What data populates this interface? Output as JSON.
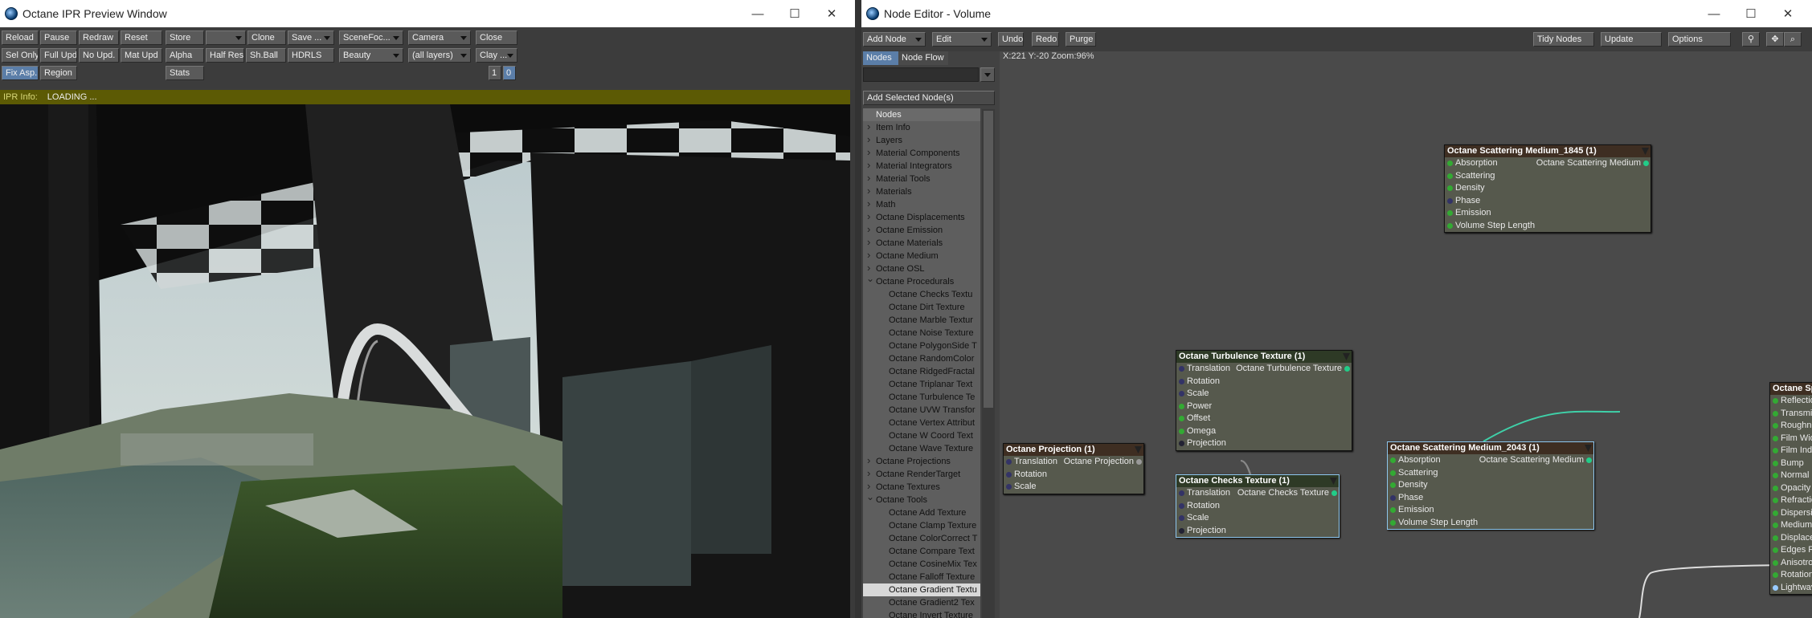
{
  "ipr": {
    "title": "Octane IPR Preview Window",
    "row1": [
      "Reload",
      "Pause",
      "Redraw",
      "Reset",
      "Store",
      "",
      "Clone",
      "Save ...",
      "SceneFoc...",
      "Camera",
      "Close"
    ],
    "row2": [
      "Sel Only",
      "Full Upd.",
      "No Upd.",
      "Mat Upd",
      "Alpha",
      "Half Res",
      "Sh.Ball",
      "HDRLS",
      "Beauty",
      "(all layers)",
      "Clay ..."
    ],
    "row3": [
      "Fix Asp.",
      "Region",
      "Stats",
      "1",
      "0"
    ],
    "info_label": "IPR Info:",
    "info_text": "LOADING ..."
  },
  "node_editor": {
    "title": "Node Editor - Volume",
    "toolbar": [
      "Add Node",
      "Edit",
      "Undo",
      "Redo",
      "Purge",
      "Tidy Nodes",
      "Update",
      "Options"
    ],
    "tabs": [
      "Nodes",
      "Node Flow"
    ],
    "add_selected": "Add Selected Node(s)",
    "coords": "X:221 Y:-20 Zoom:96%",
    "tree_header": "Nodes",
    "tree_items": [
      {
        "label": "Item Info",
        "kind": "cat"
      },
      {
        "label": "Layers",
        "kind": "cat"
      },
      {
        "label": "Material Components",
        "kind": "cat"
      },
      {
        "label": "Material Integrators",
        "kind": "cat"
      },
      {
        "label": "Material Tools",
        "kind": "cat"
      },
      {
        "label": "Materials",
        "kind": "cat"
      },
      {
        "label": "Math",
        "kind": "cat"
      },
      {
        "label": "Octane Displacements",
        "kind": "cat"
      },
      {
        "label": "Octane Emission",
        "kind": "cat"
      },
      {
        "label": "Octane Materials",
        "kind": "cat"
      },
      {
        "label": "Octane Medium",
        "kind": "cat"
      },
      {
        "label": "Octane OSL",
        "kind": "cat"
      },
      {
        "label": "Octane Procedurals",
        "kind": "open"
      },
      {
        "label": "Octane Checks Textu",
        "kind": "sub"
      },
      {
        "label": "Octane Dirt Texture",
        "kind": "sub"
      },
      {
        "label": "Octane Marble Textur",
        "kind": "sub"
      },
      {
        "label": "Octane Noise Texture",
        "kind": "sub"
      },
      {
        "label": "Octane PolygonSide T",
        "kind": "sub"
      },
      {
        "label": "Octane RandomColor",
        "kind": "sub"
      },
      {
        "label": "Octane RidgedFractal",
        "kind": "sub"
      },
      {
        "label": "Octane Triplanar Text",
        "kind": "sub"
      },
      {
        "label": "Octane Turbulence Te",
        "kind": "sub"
      },
      {
        "label": "Octane UVW Transfor",
        "kind": "sub"
      },
      {
        "label": "Octane Vertex Attribut",
        "kind": "sub"
      },
      {
        "label": "Octane W Coord Text",
        "kind": "sub"
      },
      {
        "label": "Octane Wave Texture",
        "kind": "sub"
      },
      {
        "label": "Octane Projections",
        "kind": "cat"
      },
      {
        "label": "Octane RenderTarget",
        "kind": "cat"
      },
      {
        "label": "Octane Textures",
        "kind": "cat"
      },
      {
        "label": "Octane Tools",
        "kind": "open"
      },
      {
        "label": "Octane Add Texture",
        "kind": "sub"
      },
      {
        "label": "Octane Clamp Texture",
        "kind": "sub"
      },
      {
        "label": "Octane ColorCorrect T",
        "kind": "sub"
      },
      {
        "label": "Octane Compare Text",
        "kind": "sub"
      },
      {
        "label": "Octane CosineMix Tex",
        "kind": "sub"
      },
      {
        "label": "Octane Falloff Texture",
        "kind": "sub"
      },
      {
        "label": "Octane Gradient Textu",
        "kind": "sub hl"
      },
      {
        "label": "Octane Gradient2 Tex",
        "kind": "sub"
      },
      {
        "label": "Octane Invert Texture",
        "kind": "sub"
      }
    ],
    "nodes": {
      "scatter1845": {
        "title": "Octane Scattering Medium_1845 (1)",
        "inputs": [
          "Absorption",
          "Scattering",
          "Density",
          "Phase",
          "Emission",
          "Volume Step Length"
        ],
        "output": "Octane Scattering Medium"
      },
      "turbulence": {
        "title": "Octane Turbulence Texture (1)",
        "inputs": [
          "Translation",
          "Rotation",
          "Scale",
          "Power",
          "Offset",
          "Omega",
          "Projection"
        ],
        "output": "Octane Turbulence Texture"
      },
      "projection": {
        "title": "Octane Projection (1)",
        "inputs": [
          "Translation",
          "Rotation",
          "Scale"
        ],
        "output": "Octane Projection"
      },
      "checks": {
        "title": "Octane Checks Texture (1)",
        "inputs": [
          "Translation",
          "Rotation",
          "Scale",
          "Projection"
        ],
        "output": "Octane Checks Texture"
      },
      "scatter2043": {
        "title": "Octane Scattering Medium_2043 (1)",
        "inputs": [
          "Absorption",
          "Scattering",
          "Density",
          "Phase",
          "Emission",
          "Volume Step Length"
        ],
        "output": "Octane Scattering Medium"
      },
      "specular": {
        "title": "Octane Specular Material (",
        "inputs": [
          "Reflection",
          "Transmission",
          "Roughness",
          "Film Width",
          "Film Index",
          "Bump",
          "Normal",
          "Opacity",
          "Refraction Index",
          "Dispersion",
          "Medium",
          "Displacement",
          "Edges Rounding",
          "Anisotropy",
          "Rotation",
          "Lightwave Material"
        ],
        "output": "O"
      }
    }
  }
}
